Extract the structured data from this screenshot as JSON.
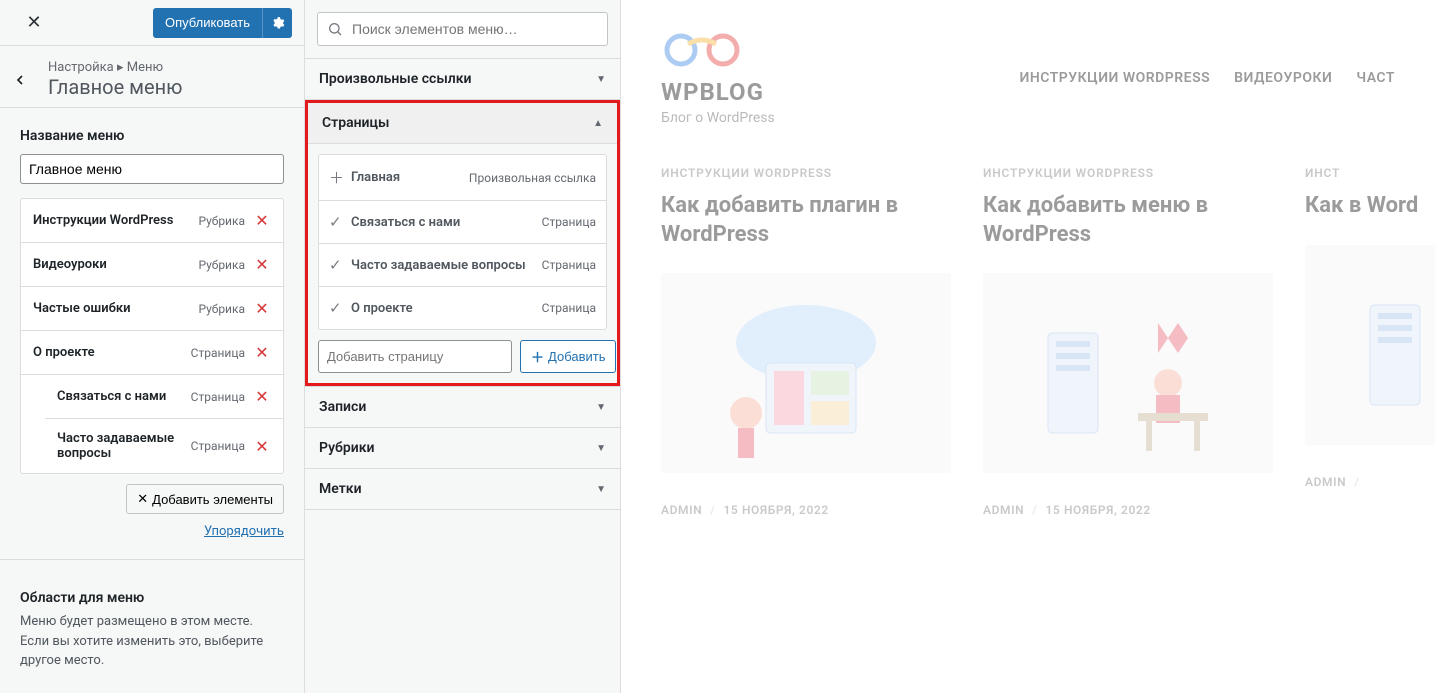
{
  "sidebar": {
    "publish_label": "Опубликовать",
    "breadcrumb_root": "Настройка",
    "breadcrumb_sep": "▸",
    "breadcrumb_leaf": "Меню",
    "panel_title": "Главное меню",
    "menu_name_label": "Название меню",
    "menu_name_value": "Главное меню",
    "items": [
      {
        "title": "Инструкции WordPress",
        "type": "Рубрика",
        "indent": 0
      },
      {
        "title": "Видеоуроки",
        "type": "Рубрика",
        "indent": 0
      },
      {
        "title": "Частые ошибки",
        "type": "Рубрика",
        "indent": 0
      },
      {
        "title": "О проекте",
        "type": "Страница",
        "indent": 0
      },
      {
        "title": "Связаться с нами",
        "type": "Страница",
        "indent": 1
      },
      {
        "title": "Часто задаваемые вопросы",
        "type": "Страница",
        "indent": 1
      }
    ],
    "add_elements_label": "Добавить элементы",
    "reorder_label": "Упорядочить",
    "locations_title": "Области для меню",
    "locations_desc": "Меню будет размещено в этом месте. Если вы хотите изменить это, выберите другое место."
  },
  "middle": {
    "search_placeholder": "Поиск элементов меню…",
    "sections": {
      "custom_links": "Произвольные ссылки",
      "pages": "Страницы",
      "posts": "Записи",
      "categories": "Рубрики",
      "tags": "Метки"
    },
    "page_items": [
      {
        "icon": "plus",
        "title": "Главная",
        "type": "Произвольная ссылка"
      },
      {
        "icon": "check",
        "title": "Связаться с нами",
        "type": "Страница"
      },
      {
        "icon": "check",
        "title": "Часто задаваемые вопросы",
        "type": "Страница"
      },
      {
        "icon": "check",
        "title": "О проекте",
        "type": "Страница"
      }
    ],
    "add_page_placeholder": "Добавить страницу",
    "add_btn_label": "Добавить"
  },
  "preview": {
    "site_title": "WPBLOG",
    "site_tagline": "Блог о WordPress",
    "nav": [
      "ИНСТРУКЦИИ WORDPRESS",
      "ВИДЕОУРОКИ",
      "ЧАСТ"
    ],
    "posts": [
      {
        "cat": "ИНСТРУКЦИИ WORDPRESS",
        "title": "Как добавить плагин в WordPress",
        "author": "ADMIN",
        "date": "15 НОЯБРЯ, 2022"
      },
      {
        "cat": "ИНСТРУКЦИИ WORDPRESS",
        "title": "Как добавить меню в WordPress",
        "author": "ADMIN",
        "date": "15 НОЯБРЯ, 2022"
      },
      {
        "cat": "ИНСТ",
        "title": "Как в Word",
        "author": "ADMIN",
        "date": ""
      }
    ]
  }
}
